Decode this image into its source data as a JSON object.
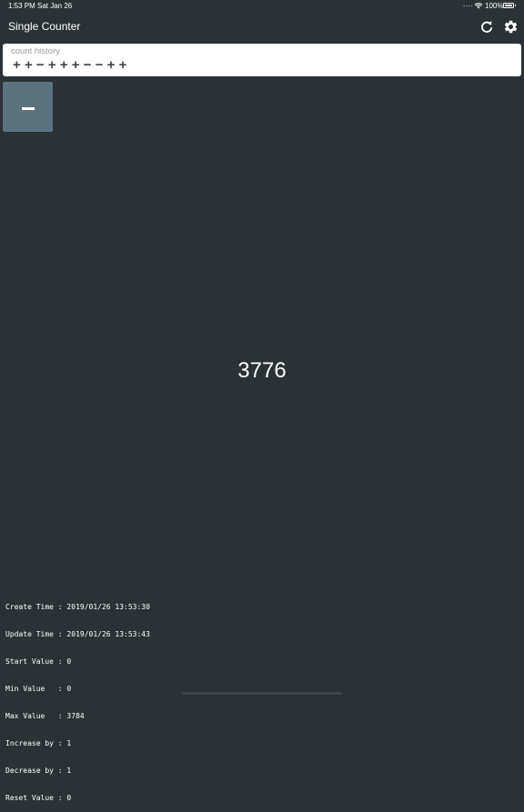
{
  "status_bar": {
    "time": "1:53 PM",
    "date": "Sat Jan 26",
    "signal_dots": "....",
    "battery_percent": "100%"
  },
  "nav": {
    "title": "Single Counter",
    "refresh_icon": "refresh-icon",
    "settings_icon": "gear-icon"
  },
  "history": {
    "label": "count history",
    "symbols": "++−+++−−++"
  },
  "decrement_button": {
    "icon": "minus-icon",
    "color": "#5b737e"
  },
  "counter": {
    "value": "3776"
  },
  "info": {
    "lines": [
      "Create Time : 2019/01/26 13:53:30",
      "Update Time : 2019/01/26 13:53:43",
      "Start Value : 0",
      "Min Value   : 0",
      "Max Value   : 3784",
      "Increase by : 1",
      "Decrease by : 1",
      "Reset Value : 0"
    ]
  },
  "colors": {
    "background": "#2b3236",
    "panel": "#ffffff",
    "button": "#5b737e",
    "text": "#ffffff"
  }
}
